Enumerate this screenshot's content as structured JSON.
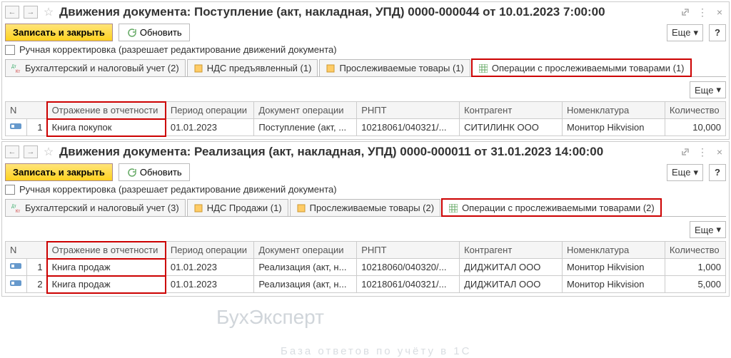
{
  "common": {
    "refresh": "Обновить",
    "more": "Еще",
    "help": "?",
    "manual_edit": "Ручная корректировка (разрешает редактирование движений документа)",
    "save_close": "Записать и закрыть",
    "cols": {
      "n": "N",
      "report": "Отражение в отчетности",
      "period": "Период операции",
      "doc": "Документ операции",
      "rnpt": "РНПТ",
      "ctr": "Контрагент",
      "nom": "Номенклатура",
      "qty": "Количество"
    }
  },
  "panes": [
    {
      "title": "Движения документа: Поступление (акт, накладная, УПД) 0000-000044 от 10.01.2023 7:00:00",
      "tabs": [
        {
          "label": "Бухгалтерский и налоговый учет (2)"
        },
        {
          "label": "НДС предъявленный (1)"
        },
        {
          "label": "Прослеживаемые товары (1)"
        },
        {
          "label": "Операции с прослеживаемыми товарами (1)"
        }
      ],
      "rows": [
        {
          "n": "1",
          "report": "Книга покупок",
          "period": "01.01.2023",
          "doc": "Поступление (акт, ...",
          "rnpt": "10218061/040321/...",
          "ctr": "СИТИЛИНК ООО",
          "nom": "Монитор Hikvision",
          "qty": "10,000"
        }
      ]
    },
    {
      "title": "Движения документа: Реализация (акт, накладная, УПД) 0000-000011 от 31.01.2023 14:00:00",
      "tabs": [
        {
          "label": "Бухгалтерский и налоговый учет (3)"
        },
        {
          "label": "НДС Продажи (1)"
        },
        {
          "label": "Прослеживаемые товары (2)"
        },
        {
          "label": "Операции с прослеживаемыми товарами (2)"
        }
      ],
      "rows": [
        {
          "n": "1",
          "report": "Книга продаж",
          "period": "01.01.2023",
          "doc": "Реализация (акт, н...",
          "rnpt": "10218060/040320/...",
          "ctr": "ДИДЖИТАЛ ООО",
          "nom": "Монитор Hikvision",
          "qty": "1,000"
        },
        {
          "n": "2",
          "report": "Книга продаж",
          "period": "01.01.2023",
          "doc": "Реализация (акт, н...",
          "rnpt": "10218061/040321/...",
          "ctr": "ДИДЖИТАЛ ООО",
          "nom": "Монитор Hikvision",
          "qty": "5,000"
        }
      ]
    }
  ],
  "watermark": {
    "a": "БухЭксперт",
    "b": "База ответов по учёту в 1С"
  }
}
